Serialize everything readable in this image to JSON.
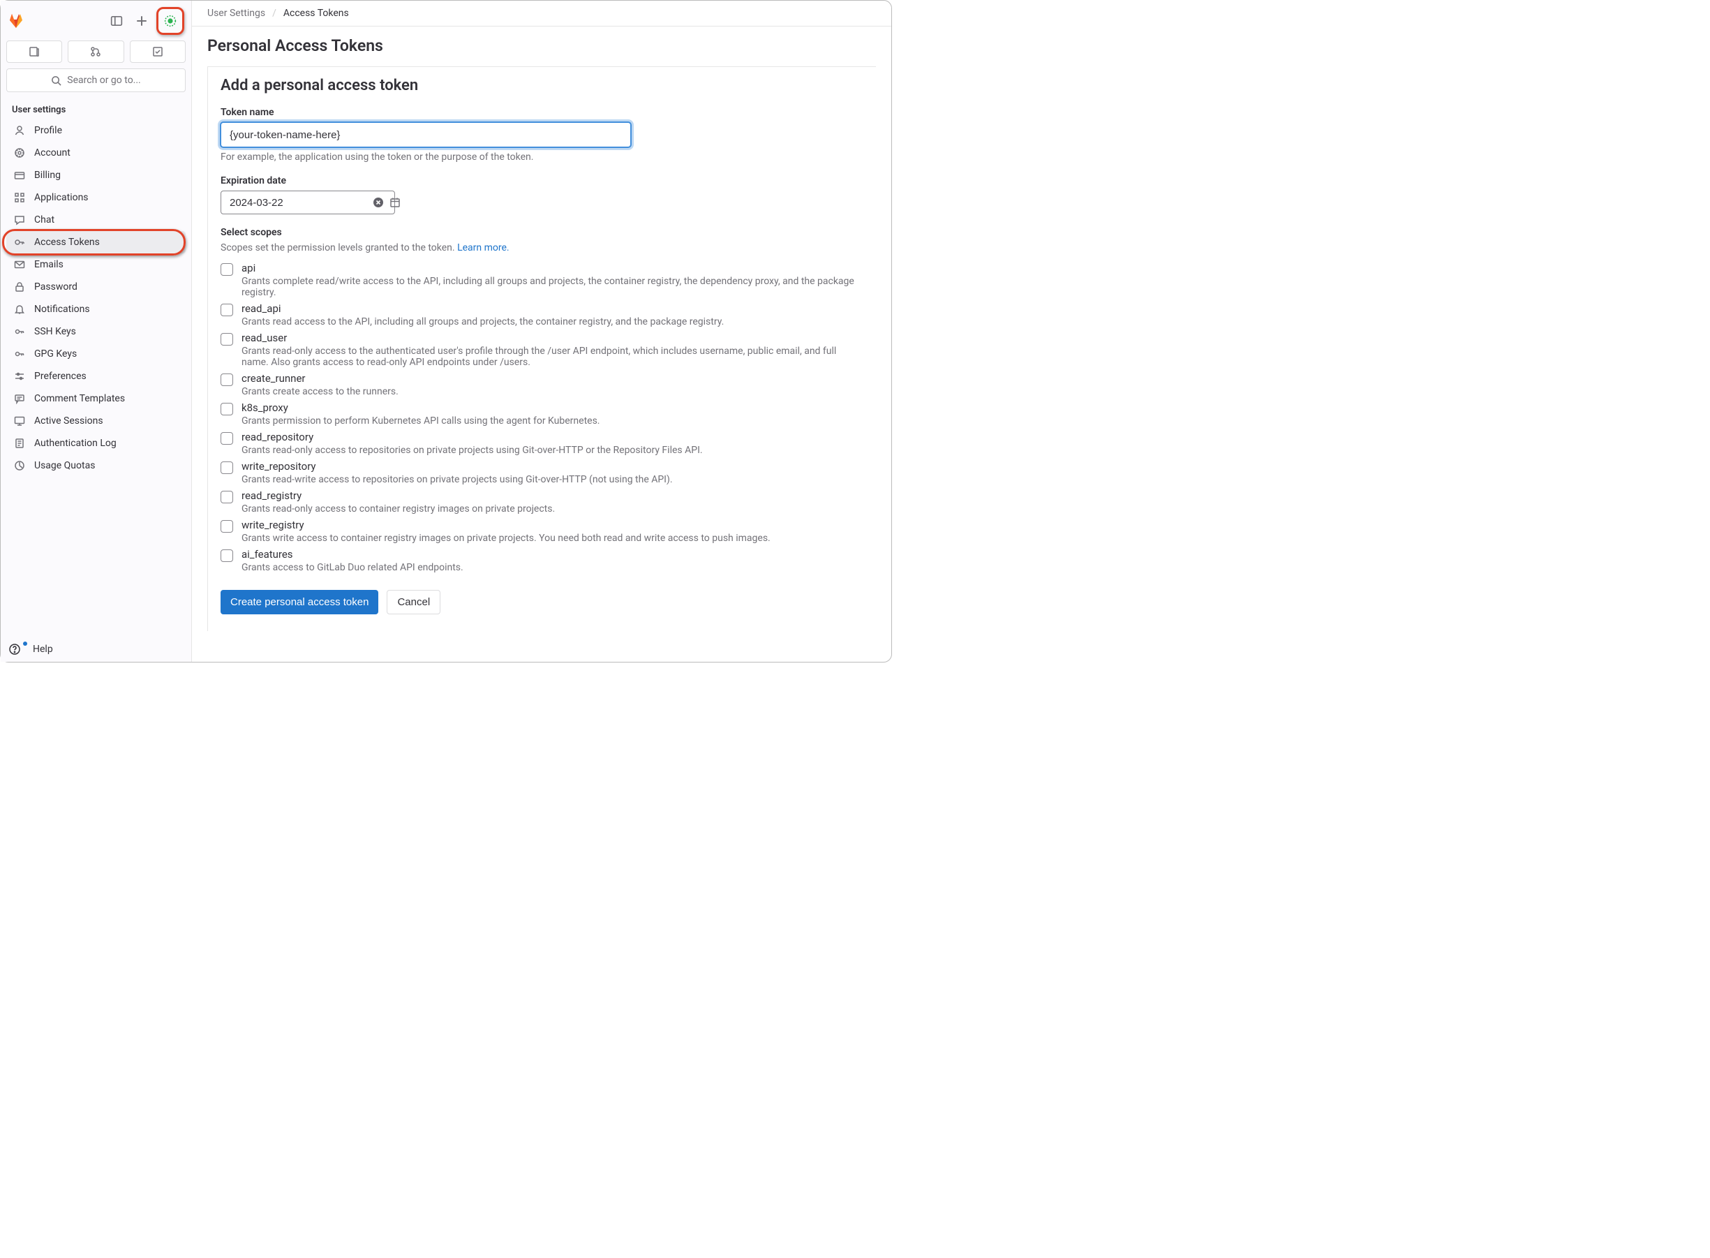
{
  "sidebar": {
    "search_placeholder": "Search or go to...",
    "section_title": "User settings",
    "items": [
      {
        "label": "Profile",
        "icon": "profile-icon"
      },
      {
        "label": "Account",
        "icon": "account-icon"
      },
      {
        "label": "Billing",
        "icon": "billing-icon"
      },
      {
        "label": "Applications",
        "icon": "applications-icon"
      },
      {
        "label": "Chat",
        "icon": "chat-icon"
      },
      {
        "label": "Access Tokens",
        "icon": "access-tokens-icon",
        "active": true
      },
      {
        "label": "Emails",
        "icon": "emails-icon"
      },
      {
        "label": "Password",
        "icon": "password-icon"
      },
      {
        "label": "Notifications",
        "icon": "notifications-icon"
      },
      {
        "label": "SSH Keys",
        "icon": "ssh-keys-icon"
      },
      {
        "label": "GPG Keys",
        "icon": "gpg-keys-icon"
      },
      {
        "label": "Preferences",
        "icon": "preferences-icon"
      },
      {
        "label": "Comment Templates",
        "icon": "comment-templates-icon"
      },
      {
        "label": "Active Sessions",
        "icon": "active-sessions-icon"
      },
      {
        "label": "Authentication Log",
        "icon": "auth-log-icon"
      },
      {
        "label": "Usage Quotas",
        "icon": "usage-quotas-icon"
      }
    ],
    "help_label": "Help"
  },
  "breadcrumb": {
    "parent": "User Settings",
    "current": "Access Tokens"
  },
  "page": {
    "title": "Personal Access Tokens",
    "form_heading": "Add a personal access token",
    "token_name_label": "Token name",
    "token_name_value": "{your-token-name-here}",
    "token_name_help": "For example, the application using the token or the purpose of the token.",
    "expiration_label": "Expiration date",
    "expiration_value": "2024-03-22",
    "scopes_heading": "Select scopes",
    "scopes_desc_prefix": "Scopes set the permission levels granted to the token. ",
    "scopes_learn_more": "Learn more.",
    "create_button": "Create personal access token",
    "cancel_button": "Cancel",
    "scopes": [
      {
        "name": "api",
        "desc": "Grants complete read/write access to the API, including all groups and projects, the container registry, the dependency proxy, and the package registry."
      },
      {
        "name": "read_api",
        "desc": "Grants read access to the API, including all groups and projects, the container registry, and the package registry."
      },
      {
        "name": "read_user",
        "desc": "Grants read-only access to the authenticated user's profile through the /user API endpoint, which includes username, public email, and full name. Also grants access to read-only API endpoints under /users."
      },
      {
        "name": "create_runner",
        "desc": "Grants create access to the runners."
      },
      {
        "name": "k8s_proxy",
        "desc": "Grants permission to perform Kubernetes API calls using the agent for Kubernetes."
      },
      {
        "name": "read_repository",
        "desc": "Grants read-only access to repositories on private projects using Git-over-HTTP or the Repository Files API."
      },
      {
        "name": "write_repository",
        "desc": "Grants read-write access to repositories on private projects using Git-over-HTTP (not using the API)."
      },
      {
        "name": "read_registry",
        "desc": "Grants read-only access to container registry images on private projects."
      },
      {
        "name": "write_registry",
        "desc": "Grants write access to container registry images on private projects. You need both read and write access to push images."
      },
      {
        "name": "ai_features",
        "desc": "Grants access to GitLab Duo related API endpoints."
      }
    ]
  }
}
